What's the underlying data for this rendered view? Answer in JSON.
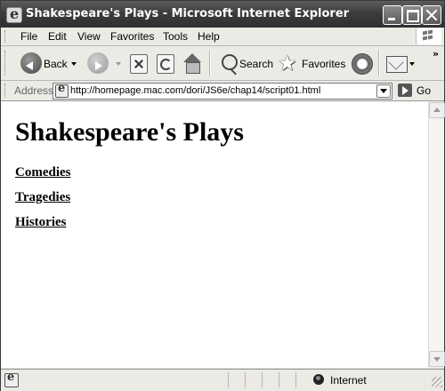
{
  "window": {
    "title": "Shakespeare's Plays - Microsoft Internet Explorer"
  },
  "menubar": {
    "items": [
      "File",
      "Edit",
      "View",
      "Favorites",
      "Tools",
      "Help"
    ]
  },
  "toolbar": {
    "back_label": "Back",
    "search_label": "Search",
    "favorites_label": "Favorites",
    "overflow_label": "»"
  },
  "address": {
    "label": "Address",
    "url": "http://homepage.mac.com/dori/JS6e/chap14/script01.html",
    "go_label": "Go"
  },
  "page": {
    "heading": "Shakespeare's Plays",
    "links": [
      "Comedies",
      "Tragedies",
      "Histories"
    ]
  },
  "status": {
    "zone": "Internet"
  },
  "icons": [
    "ie-page-icon",
    "minimize-icon",
    "maximize-icon",
    "close-icon",
    "windows-logo-icon",
    "back-arrow-icon",
    "forward-arrow-icon",
    "stop-icon",
    "refresh-icon",
    "home-icon",
    "search-icon",
    "favorites-star-icon",
    "history-icon",
    "mail-icon",
    "go-arrow-icon",
    "globe-icon"
  ]
}
